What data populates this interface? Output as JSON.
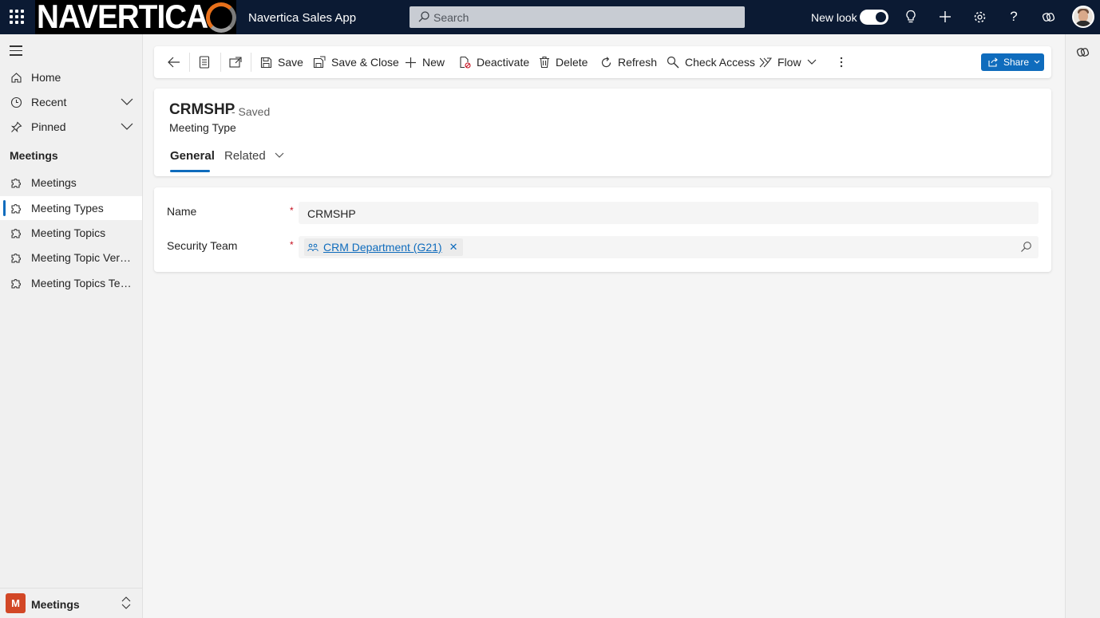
{
  "topbar": {
    "logo_text": "NAVERTICA",
    "app_title": "Navertica Sales App",
    "search_placeholder": "Search",
    "new_look_label": "New look",
    "new_look_enabled": true,
    "icons": [
      "waffle-icon",
      "lightbulb-icon",
      "plus-icon",
      "settings-icon",
      "help-icon",
      "copilot-icon"
    ]
  },
  "sidebar": {
    "top_items": [
      {
        "label": "Home",
        "icon": "home-icon"
      },
      {
        "label": "Recent",
        "icon": "clock-icon",
        "expandable": true
      },
      {
        "label": "Pinned",
        "icon": "pin-icon",
        "expandable": true
      }
    ],
    "section_title": "Meetings",
    "section_items": [
      {
        "label": "Meetings",
        "icon": "puzzle-icon",
        "active": false
      },
      {
        "label": "Meeting Types",
        "icon": "puzzle-icon",
        "active": true
      },
      {
        "label": "Meeting Topics",
        "icon": "puzzle-icon",
        "active": false
      },
      {
        "label": "Meeting Topic Versio...",
        "icon": "puzzle-icon",
        "active": false
      },
      {
        "label": "Meeting Topics Temp...",
        "icon": "puzzle-icon",
        "active": false
      }
    ],
    "area": {
      "badge": "M",
      "label": "Meetings",
      "badge_color": "#d24726"
    }
  },
  "commandbar": {
    "save": "Save",
    "save_close": "Save & Close",
    "new": "New",
    "deactivate": "Deactivate",
    "delete": "Delete",
    "refresh": "Refresh",
    "check_access": "Check Access",
    "flow": "Flow",
    "share": "Share"
  },
  "record": {
    "title": "CRMSHP",
    "status": "- Saved",
    "entity": "Meeting Type",
    "tabs": [
      {
        "label": "General",
        "active": true
      },
      {
        "label": "Related",
        "active": false
      }
    ]
  },
  "form": {
    "name_label": "Name",
    "name_value": "CRMSHP",
    "team_label": "Security Team",
    "team_value": "CRM Department (G21)",
    "required_marker": "*"
  },
  "colors": {
    "topbar_bg": "#0b1a33",
    "accent": "#0f6cbd",
    "required": "#c50f1f"
  }
}
